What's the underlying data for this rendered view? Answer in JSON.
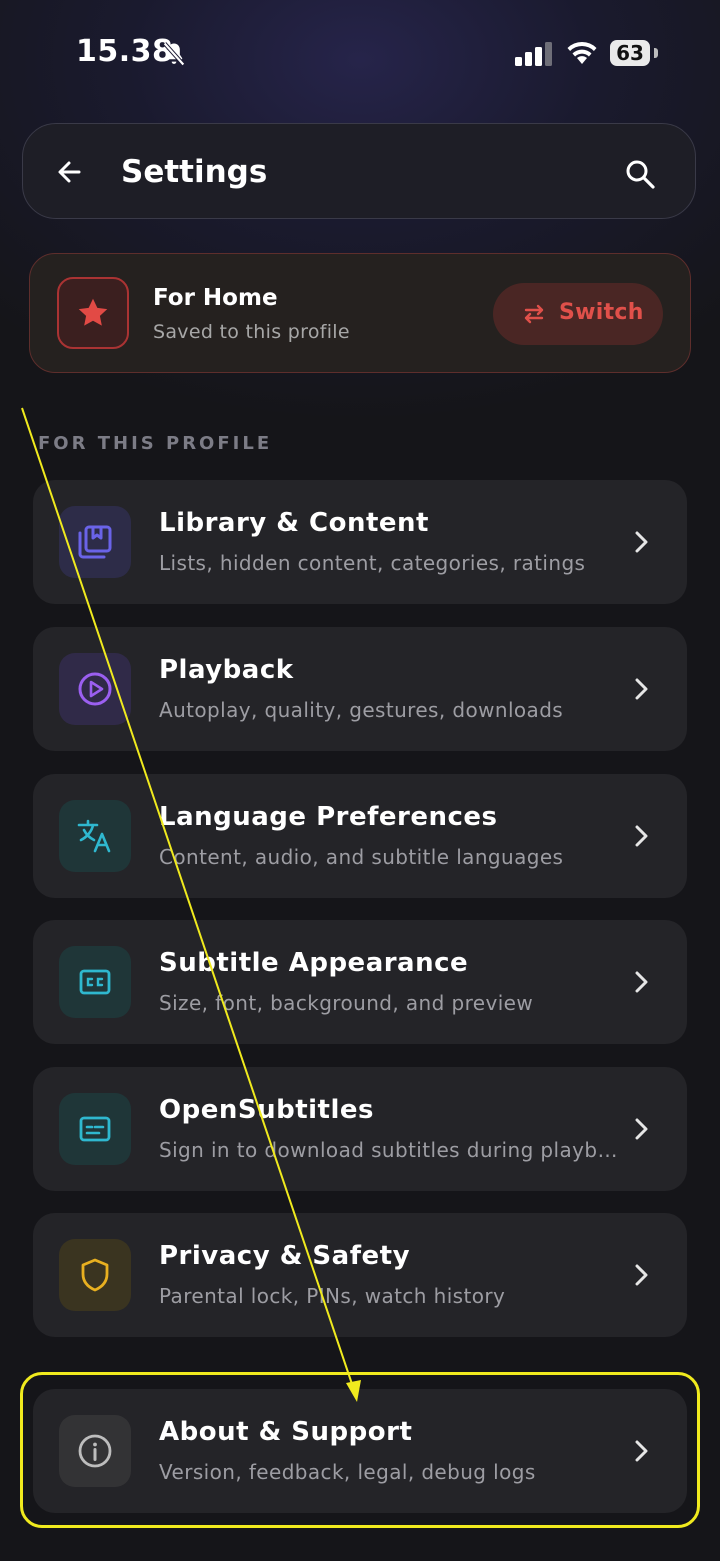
{
  "status_bar": {
    "time": "15.38",
    "battery": "63"
  },
  "header": {
    "title": "Settings",
    "back_icon": "arrow-left-icon",
    "search_icon": "search-icon"
  },
  "profile": {
    "name": "For Home",
    "subtitle": "Saved to this profile",
    "icon": "star-icon",
    "switch_label": "Switch",
    "accent_color": "#e0504a"
  },
  "section_label": "FOR THIS PROFILE",
  "settings_items": [
    {
      "title": "Library & Content",
      "subtitle": "Lists, hidden content, categories, ratings",
      "icon": "library-icon",
      "color": "#6a63e8"
    },
    {
      "title": "Playback",
      "subtitle": "Autoplay, quality, gestures, downloads",
      "icon": "play-circle-icon",
      "color": "#9b5ff0"
    },
    {
      "title": "Language Preferences",
      "subtitle": "Content, audio, and subtitle languages",
      "icon": "translate-icon",
      "color": "#2fb8cf"
    },
    {
      "title": "Subtitle Appearance",
      "subtitle": "Size, font, background, and preview",
      "icon": "closed-captions-icon",
      "color": "#2fb8cf"
    },
    {
      "title": "OpenSubtitles",
      "subtitle": "Sign in to download subtitles during playback",
      "icon": "subtitles-icon",
      "color": "#2fb8cf"
    },
    {
      "title": "Privacy & Safety",
      "subtitle": "Parental lock, PINs, watch history",
      "icon": "shield-icon",
      "color": "#e8b020"
    },
    {
      "title": "About & Support",
      "subtitle": "Version, feedback, legal, debug logs",
      "icon": "info-icon",
      "color": "#bdbdbd"
    }
  ],
  "annotation_color": "#f0ea1e"
}
